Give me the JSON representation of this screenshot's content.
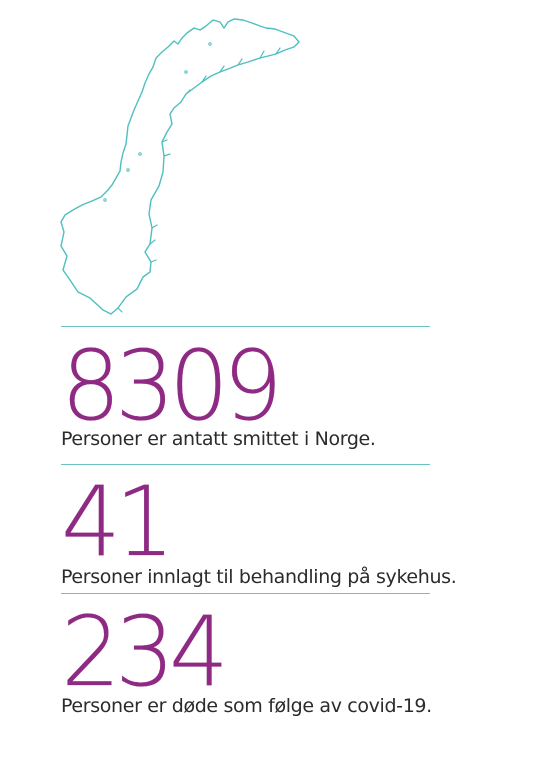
{
  "colors": {
    "accent": "#8e2a83",
    "divider": "#6cc3c3",
    "map_outline": "#4fbfbf",
    "text": "#2b2b2b"
  },
  "map": {
    "icon": "norway-map-outline-icon"
  },
  "stats": [
    {
      "value": "8309",
      "label": "Personer er antatt smittet i Norge."
    },
    {
      "value": "41",
      "label": "Personer innlagt til behandling på sykehus."
    },
    {
      "value": "234",
      "label": "Personer er døde som følge av covid-19."
    }
  ]
}
